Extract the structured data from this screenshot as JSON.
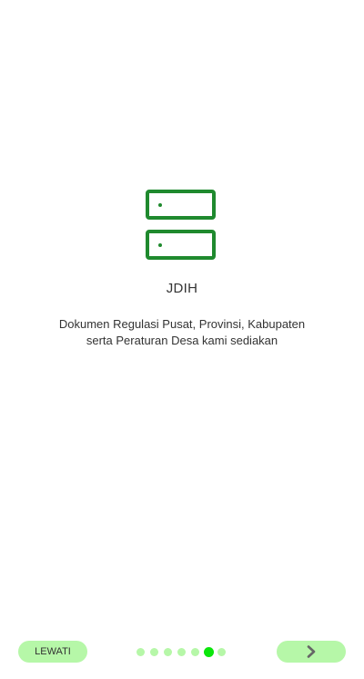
{
  "onboarding": {
    "icon": "server-icon",
    "title": "JDIH",
    "description_line1": "Dokumen Regulasi Pusat, Provinsi, Kabupaten",
    "description_line2": "serta Peraturan Desa kami sediakan"
  },
  "footer": {
    "skip_label": "LEWATI",
    "next_icon": "chevron-right-icon",
    "page_count": 7,
    "current_page": 6
  },
  "colors": {
    "icon_green": "#1f8a2e",
    "button_bg": "#b6f7a8",
    "dot_inactive": "#b6f7a8",
    "dot_active": "#0be60b",
    "text": "#333333"
  }
}
